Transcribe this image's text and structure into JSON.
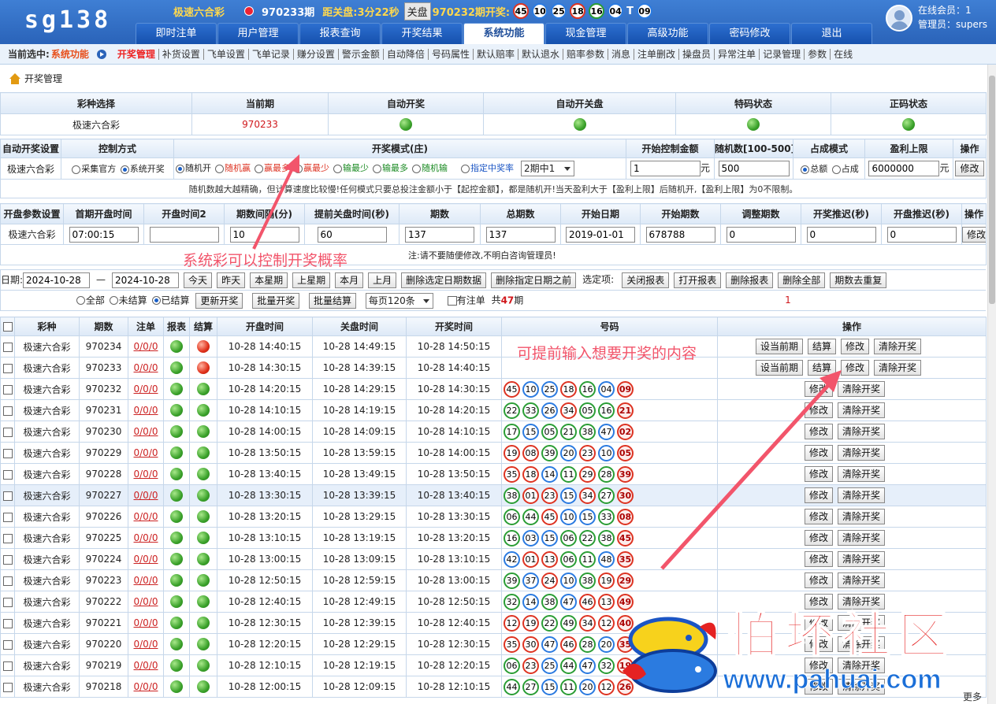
{
  "header": {
    "logo": "sg138",
    "game_name": "极速六合彩",
    "current_period": "970233期",
    "countdown_label": "距关盘:",
    "countdown_value": "3分22秒",
    "closed_badge": "关盘",
    "prev_period_label": "970232期开奖:",
    "prev_balls": [
      "45",
      "10",
      "25",
      "18",
      "16",
      "04"
    ],
    "prev_special_sep": "T",
    "prev_special": "09",
    "nav_tabs": [
      "即时注单",
      "用户管理",
      "报表查询",
      "开奖结果",
      "系统功能",
      "现金管理",
      "高级功能",
      "密码修改",
      "退出"
    ],
    "active_tab": "系统功能",
    "online_members": "在线会员：1",
    "admin": "管理员：supers"
  },
  "subnav": {
    "current_label": "当前选中:",
    "current_value": "系统功能",
    "items": [
      "开奖管理",
      "补货设置",
      "飞单设置",
      "飞单记录",
      "赚分设置",
      "警示金额",
      "自动降倍",
      "号码属性",
      "默认赔率",
      "默认退水",
      "赔率参数",
      "消息",
      "注单删改",
      "操盘员",
      "异常注单",
      "记录管理",
      "参数",
      "在线"
    ]
  },
  "section_title": "开奖管理",
  "status_table": {
    "headers": [
      "彩种选择",
      "当前期",
      "自动开奖",
      "自动开关盘",
      "特码状态",
      "正码状态"
    ],
    "game": "极速六合彩",
    "period": "970233"
  },
  "auto_settings": {
    "headers": [
      "自动开奖设置",
      "控制方式",
      "开奖模式(庄)",
      "开始控制金额",
      "随机数[100-500]",
      "占成模式",
      "盈利上限",
      "操作"
    ],
    "row_label": "极速六合彩",
    "control_options": [
      "采集官方",
      "系统开奖"
    ],
    "mode_options": [
      "随机开",
      "随机赢",
      "赢最多",
      "赢最少",
      "输最少",
      "输最多",
      "随机输",
      "指定中奖率"
    ],
    "period_select": "2期中1",
    "start_amount": "1",
    "unit_yuan": "元",
    "random_number": "500",
    "share_options": [
      "总额",
      "占成"
    ],
    "profit_limit": "6000000",
    "modify": "修改",
    "note": "随机数越大越精确，但计算速度比较慢!任何模式只要总投注金额小于【起控金额】，都是随机开!当天盈利大于【盈利上限】后随机开,【盈利上限】为0不限制。"
  },
  "open_params": {
    "headers": [
      "开盘参数设置",
      "首期开盘时间",
      "开盘时间2",
      "期数间隔(分)",
      "提前关盘时间(秒)",
      "期数",
      "总期数",
      "开始日期",
      "开始期数",
      "调整期数",
      "开奖推迟(秒)",
      "开盘推迟(秒)",
      "操作"
    ],
    "row_label": "极速六合彩",
    "values": [
      "07:00:15",
      "",
      "10",
      "60",
      "137",
      "137",
      "2019-01-01",
      "678788",
      "0",
      "0",
      "0"
    ],
    "modify": "修改",
    "warning": "注:请不要随便修改,不明白咨询管理员!"
  },
  "filter": {
    "date_label": "日期:",
    "date_from": "2024-10-28",
    "dash": "—",
    "date_to": "2024-10-28",
    "buttons": [
      "今天",
      "昨天",
      "本星期",
      "上星期",
      "本月",
      "上月",
      "删除选定日期数据",
      "删除指定日期之前"
    ],
    "options_label": "选定项:",
    "option_buttons": [
      "关闭报表",
      "打开报表",
      "删除报表",
      "删除全部",
      "期数去重复"
    ],
    "status_options": [
      "全部",
      "未结算",
      "已结算"
    ],
    "batch_buttons": [
      "更新开奖",
      "批量开奖",
      "批量结算"
    ],
    "per_page": "每页120条",
    "has_bets": "有注单",
    "total_prefix": "共",
    "total_count": "47",
    "total_suffix": "期",
    "page": "1"
  },
  "list": {
    "headers": [
      "彩种",
      "期数",
      "注单",
      "报表",
      "结算",
      "开盘时间",
      "关盘时间",
      "开奖时间",
      "号码",
      "操作"
    ],
    "op_buttons": [
      "设当前期",
      "结算",
      "修改",
      "清除开奖"
    ],
    "rows": [
      {
        "game": "极速六合彩",
        "period": "970234",
        "bets": "0/0/0",
        "settle": "red",
        "open": "10-28 14:40:15",
        "close": "10-28 14:49:15",
        "draw": "10-28 14:50:15",
        "balls": [],
        "pending": true
      },
      {
        "game": "极速六合彩",
        "period": "970233",
        "bets": "0/0/0",
        "settle": "red",
        "open": "10-28 14:30:15",
        "close": "10-28 14:39:15",
        "draw": "10-28 14:40:15",
        "balls": [],
        "pending": true
      },
      {
        "game": "极速六合彩",
        "period": "970232",
        "bets": "0/0/0",
        "settle": "green",
        "open": "10-28 14:20:15",
        "close": "10-28 14:29:15",
        "draw": "10-28 14:30:15",
        "balls": [
          "45",
          "10",
          "25",
          "18",
          "16",
          "04",
          "09"
        ]
      },
      {
        "game": "极速六合彩",
        "period": "970231",
        "bets": "0/0/0",
        "settle": "green",
        "open": "10-28 14:10:15",
        "close": "10-28 14:19:15",
        "draw": "10-28 14:20:15",
        "balls": [
          "22",
          "33",
          "26",
          "34",
          "05",
          "16",
          "21"
        ]
      },
      {
        "game": "极速六合彩",
        "period": "970230",
        "bets": "0/0/0",
        "settle": "green",
        "open": "10-28 14:00:15",
        "close": "10-28 14:09:15",
        "draw": "10-28 14:10:15",
        "balls": [
          "17",
          "15",
          "05",
          "21",
          "38",
          "47",
          "02"
        ]
      },
      {
        "game": "极速六合彩",
        "period": "970229",
        "bets": "0/0/0",
        "settle": "green",
        "open": "10-28 13:50:15",
        "close": "10-28 13:59:15",
        "draw": "10-28 14:00:15",
        "balls": [
          "19",
          "08",
          "39",
          "20",
          "23",
          "10",
          "05"
        ]
      },
      {
        "game": "极速六合彩",
        "period": "970228",
        "bets": "0/0/0",
        "settle": "green",
        "open": "10-28 13:40:15",
        "close": "10-28 13:49:15",
        "draw": "10-28 13:50:15",
        "balls": [
          "35",
          "18",
          "14",
          "11",
          "29",
          "28",
          "39"
        ]
      },
      {
        "game": "极速六合彩",
        "period": "970227",
        "bets": "0/0/0",
        "settle": "green",
        "open": "10-28 13:30:15",
        "close": "10-28 13:39:15",
        "draw": "10-28 13:40:15",
        "balls": [
          "38",
          "01",
          "23",
          "15",
          "34",
          "27",
          "30"
        ],
        "hl": true
      },
      {
        "game": "极速六合彩",
        "period": "970226",
        "bets": "0/0/0",
        "settle": "green",
        "open": "10-28 13:20:15",
        "close": "10-28 13:29:15",
        "draw": "10-28 13:30:15",
        "balls": [
          "06",
          "44",
          "45",
          "10",
          "15",
          "33",
          "08"
        ]
      },
      {
        "game": "极速六合彩",
        "period": "970225",
        "bets": "0/0/0",
        "settle": "green",
        "open": "10-28 13:10:15",
        "close": "10-28 13:19:15",
        "draw": "10-28 13:20:15",
        "balls": [
          "16",
          "03",
          "15",
          "06",
          "22",
          "38",
          "45"
        ]
      },
      {
        "game": "极速六合彩",
        "period": "970224",
        "bets": "0/0/0",
        "settle": "green",
        "open": "10-28 13:00:15",
        "close": "10-28 13:09:15",
        "draw": "10-28 13:10:15",
        "balls": [
          "42",
          "01",
          "13",
          "06",
          "11",
          "48",
          "35"
        ]
      },
      {
        "game": "极速六合彩",
        "period": "970223",
        "bets": "0/0/0",
        "settle": "green",
        "open": "10-28 12:50:15",
        "close": "10-28 12:59:15",
        "draw": "10-28 13:00:15",
        "balls": [
          "39",
          "37",
          "24",
          "10",
          "38",
          "19",
          "29"
        ]
      },
      {
        "game": "极速六合彩",
        "period": "970222",
        "bets": "0/0/0",
        "settle": "green",
        "open": "10-28 12:40:15",
        "close": "10-28 12:49:15",
        "draw": "10-28 12:50:15",
        "balls": [
          "32",
          "14",
          "38",
          "47",
          "46",
          "13",
          "49"
        ]
      },
      {
        "game": "极速六合彩",
        "period": "970221",
        "bets": "0/0/0",
        "settle": "green",
        "open": "10-28 12:30:15",
        "close": "10-28 12:39:15",
        "draw": "10-28 12:40:15",
        "balls": [
          "12",
          "19",
          "22",
          "49",
          "34",
          "12",
          "40"
        ]
      },
      {
        "game": "极速六合彩",
        "period": "970220",
        "bets": "0/0/0",
        "settle": "green",
        "open": "10-28 12:20:15",
        "close": "10-28 12:29:15",
        "draw": "10-28 12:30:15",
        "balls": [
          "35",
          "30",
          "47",
          "46",
          "28",
          "20",
          "35"
        ]
      },
      {
        "game": "极速六合彩",
        "period": "970219",
        "bets": "0/0/0",
        "settle": "green",
        "open": "10-28 12:10:15",
        "close": "10-28 12:19:15",
        "draw": "10-28 12:20:15",
        "balls": [
          "06",
          "23",
          "25",
          "44",
          "47",
          "32",
          "19"
        ]
      },
      {
        "game": "极速六合彩",
        "period": "970218",
        "bets": "0/0/0",
        "settle": "green",
        "open": "10-28 12:00:15",
        "close": "10-28 12:09:15",
        "draw": "10-28 12:10:15",
        "balls": [
          "44",
          "27",
          "15",
          "11",
          "20",
          "12",
          "26"
        ]
      }
    ]
  },
  "annotations": {
    "a1": "系统彩可以控制开奖概率",
    "a2": "可提前输入想要开奖的内容"
  },
  "watermark": {
    "text": "怕坏社区",
    "url": "www.pahuai.com"
  },
  "more": "更多",
  "colors": {
    "header_blue": "#2a63b9",
    "accent_red": "#e22",
    "annotation_pink": "#f2556b"
  }
}
